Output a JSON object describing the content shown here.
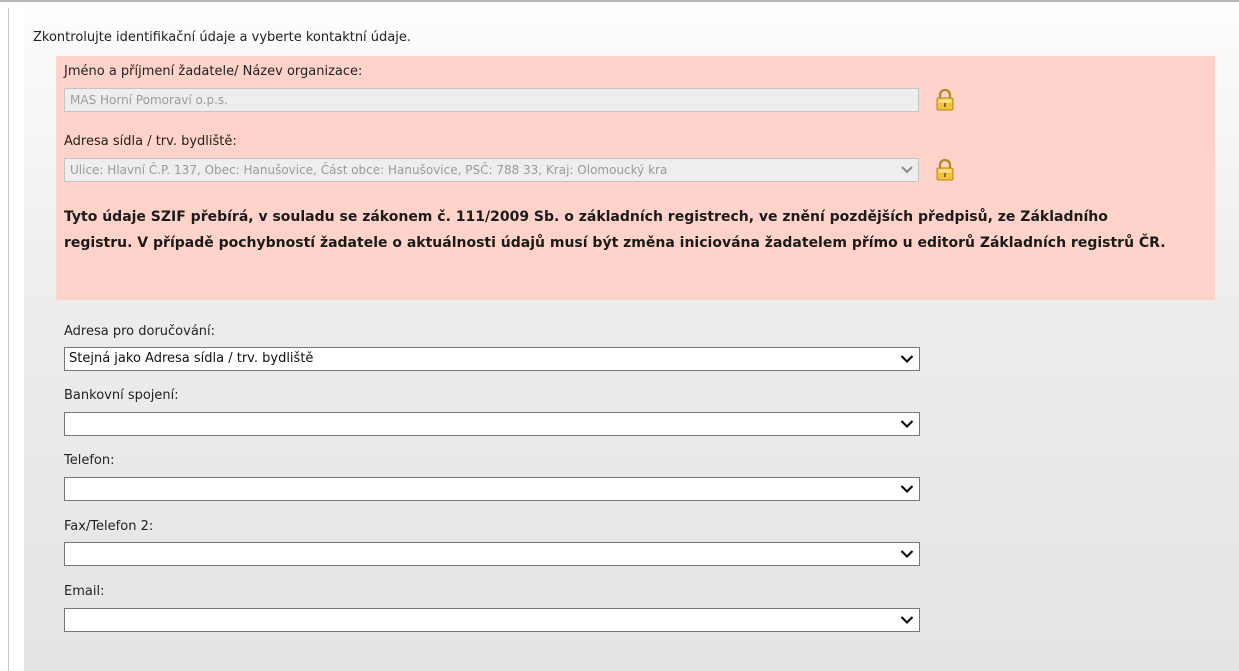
{
  "intro_text": "Zkontrolujte identifikační údaje a vyberte kontaktní údaje.",
  "locked_section": {
    "name_label": "Jméno a příjmení žadatele/ Název organizace:",
    "name_value": "MAS Horní Pomoraví o.p.s.",
    "address_label": "Adresa sídla / trv. bydliště:",
    "address_value": "Ulice: Hlavní Č.P. 137, Obec: Hanušovice, Část obce: Hanušovice, PSČ: 788 33, Kraj: Olomoucký kra",
    "notice_text": "Tyto údaje SZIF přebírá, v souladu se zákonem č. 111/2009 Sb. o základních registrech, ve znění pozdějších předpisů, ze Základního registru. V případě pochybností žadatele o aktuálnosti údajů musí být změna iniciována žadatelem přímo u editorů Základních registrů ČR.",
    "background_color": "#ffd3c9",
    "lock_icon": "padlock-icon"
  },
  "contact_fields": [
    {
      "label": "Adresa pro doručování:",
      "value": "Stejná jako Adresa sídla / trv. bydliště"
    },
    {
      "label": "Bankovní spojení:",
      "value": ""
    },
    {
      "label": "Telefon:",
      "value": ""
    },
    {
      "label": "Fax/Telefon 2:",
      "value": ""
    },
    {
      "label": "Email:",
      "value": ""
    }
  ],
  "dropdown_icon": "chevron-down-icon"
}
